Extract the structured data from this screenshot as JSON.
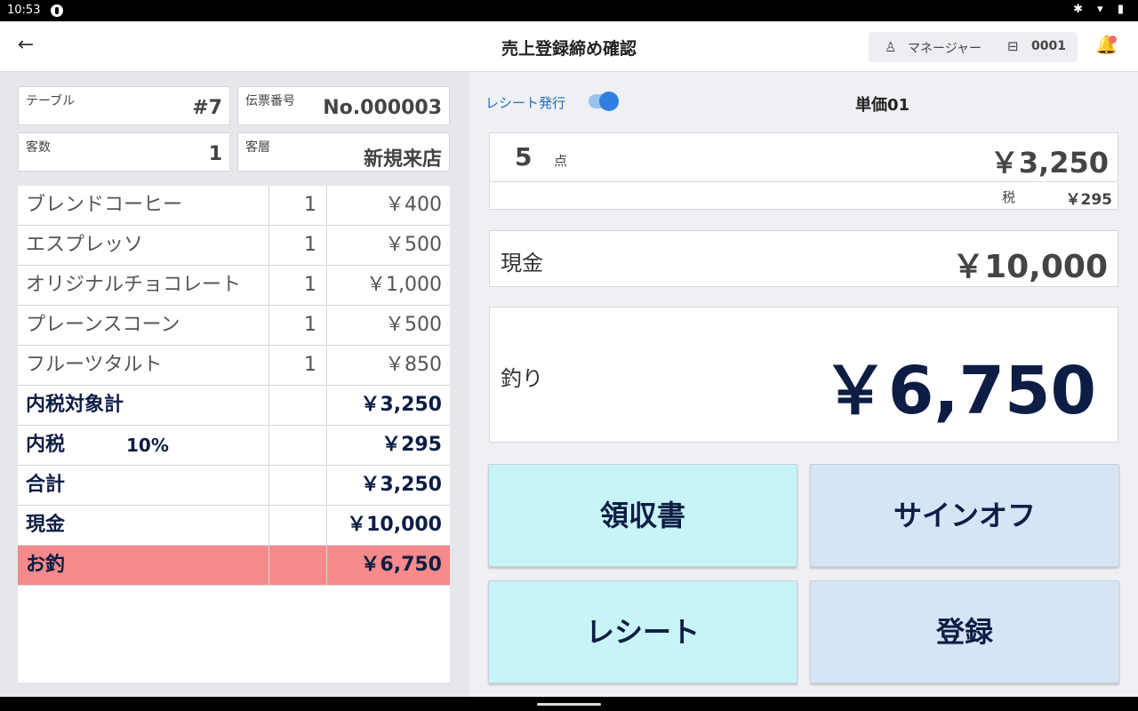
{
  "status_bar": {
    "time": "10:53",
    "icons": "✱ ▾ ▮"
  },
  "app_bar": {
    "back_icon": "←",
    "title": "売上登録締め確認",
    "user_name": "マネージャー",
    "register_number": "0001",
    "user_icon": "♙",
    "register_icon": "⊟",
    "bell_icon": "🔔"
  },
  "order_info": {
    "table_label": "テーブル",
    "table_value": "#7",
    "slip_label": "伝票番号",
    "slip_value": "No.000003",
    "guests_label": "客数",
    "guests_value": "1",
    "customer_type_label": "客層",
    "customer_type_value": "新規来店"
  },
  "items": [
    {
      "name": "ブレンドコーヒー",
      "qty": "1",
      "price": "￥400"
    },
    {
      "name": "エスプレッソ",
      "qty": "1",
      "price": "￥500"
    },
    {
      "name": "オリジナルチョコレート",
      "qty": "1",
      "price": "￥1,000"
    },
    {
      "name": "プレーンスコーン",
      "qty": "1",
      "price": "￥500"
    },
    {
      "name": "フルーツタルト",
      "qty": "1",
      "price": "￥850"
    }
  ],
  "summary": {
    "taxable_label": "内税対象計",
    "taxable_value": "￥3,250",
    "tax_label": "内税",
    "tax_rate": "10%",
    "tax_value": "￥295",
    "total_label": "合計",
    "total_value": "￥3,250",
    "cash_label": "現金",
    "cash_value": "￥10,000",
    "change_label": "お釣",
    "change_value": "￥6,750"
  },
  "checkout": {
    "receipt_toggle_label": "レシート発行",
    "receipt_toggle_on": true,
    "price_mode": "単価01",
    "item_count": "5",
    "item_unit": "点",
    "total": "￥3,250",
    "tax_label": "税",
    "tax": "￥295",
    "cash_label": "現金",
    "cash": "￥10,000",
    "change_label": "釣り",
    "change": "￥6,750"
  },
  "buttons": {
    "receipt_slip": "領収書",
    "sign_off": "サインオフ",
    "receipt": "レシート",
    "register": "登録"
  },
  "colors": {
    "change_row": "#f78a8a",
    "button_cyan": "#c7f4f7",
    "button_blue": "#d5e5f6",
    "accent": "#2f7fe0",
    "dark_text": "#0d1d44"
  }
}
